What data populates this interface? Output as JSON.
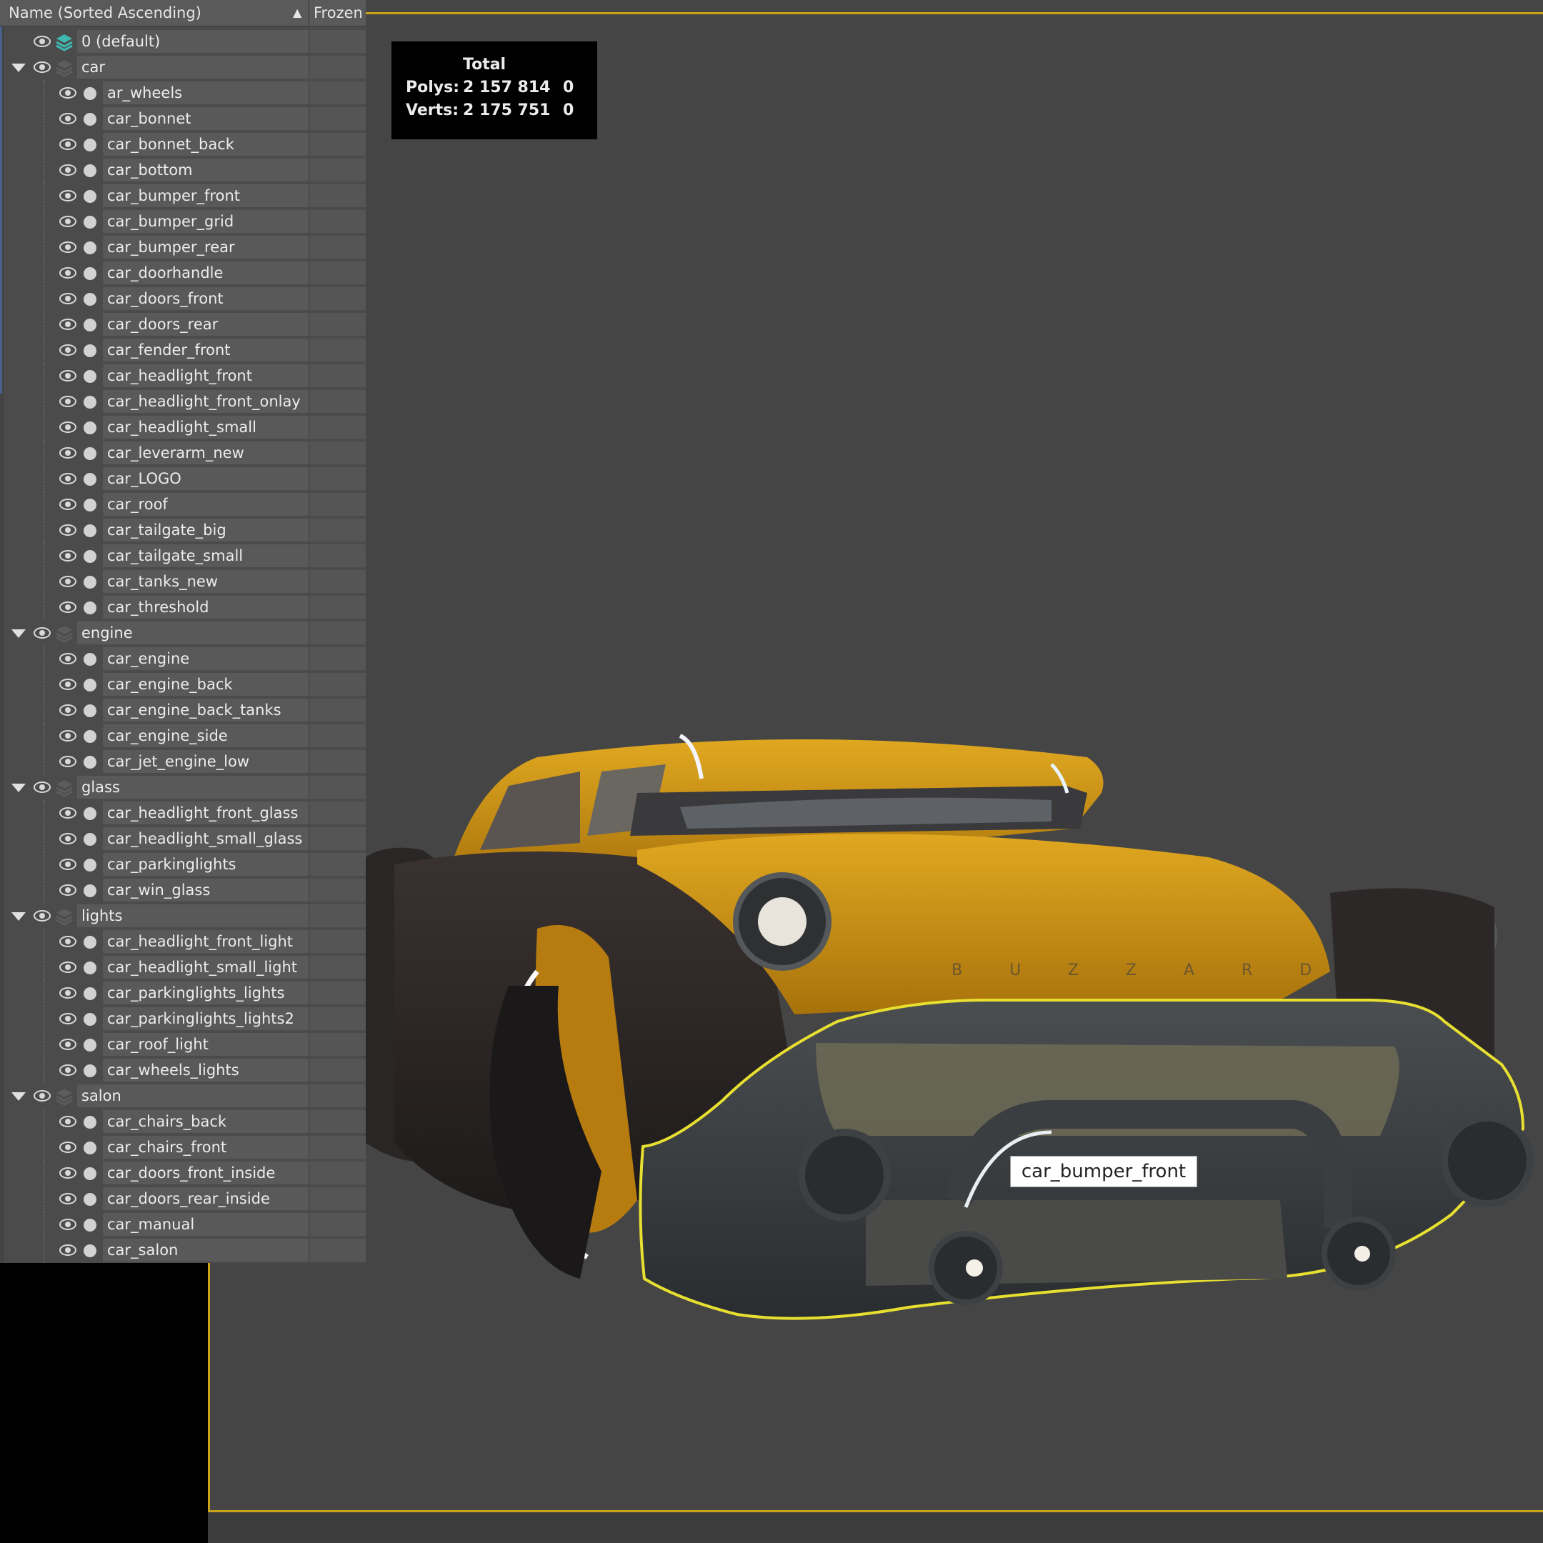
{
  "header": {
    "name_col": "Name (Sorted Ascending)",
    "frozen_col": "Frozen"
  },
  "stats": {
    "title": "Total",
    "polys_label": "Polys:",
    "polys_value": "2 157 814",
    "polys_sel": "0",
    "verts_label": "Verts:",
    "verts_value": "2 175 751",
    "verts_sel": "0"
  },
  "tooltip": "car_bumper_front",
  "car_text": "BUZZARD",
  "colors": {
    "selection_outline": "#e8e030",
    "viewport_border": "#c9a318",
    "active_layer": "#3fb8b0"
  },
  "layers": [
    {
      "name": "0 (default)",
      "children": []
    },
    {
      "name": "car",
      "children": [
        "ar_wheels",
        "car_bonnet",
        "car_bonnet_back",
        "car_bottom",
        "car_bumper_front",
        "car_bumper_grid",
        "car_bumper_rear",
        "car_doorhandle",
        "car_doors_front",
        "car_doors_rear",
        "car_fender_front",
        "car_headlight_front",
        "car_headlight_front_onlay",
        "car_headlight_small",
        "car_leverarm_new",
        "car_LOGO",
        "car_roof",
        "car_tailgate_big",
        "car_tailgate_small",
        "car_tanks_new",
        "car_threshold"
      ]
    },
    {
      "name": "engine",
      "children": [
        "car_engine",
        "car_engine_back",
        "car_engine_back_tanks",
        "car_engine_side",
        "car_jet_engine_low"
      ]
    },
    {
      "name": "glass",
      "children": [
        "car_headlight_front_glass",
        "car_headlight_small_glass",
        "car_parkinglights",
        "car_win_glass"
      ]
    },
    {
      "name": "lights",
      "children": [
        "car_headlight_front_light",
        "car_headlight_small_light",
        "car_parkinglights_lights",
        "car_parkinglights_lights2",
        "car_roof_light",
        "car_wheels_lights"
      ]
    },
    {
      "name": "salon",
      "children": [
        "car_chairs_back",
        "car_chairs_front",
        "car_doors_front_inside",
        "car_doors_rear_inside",
        "car_manual",
        "car_salon"
      ]
    }
  ]
}
